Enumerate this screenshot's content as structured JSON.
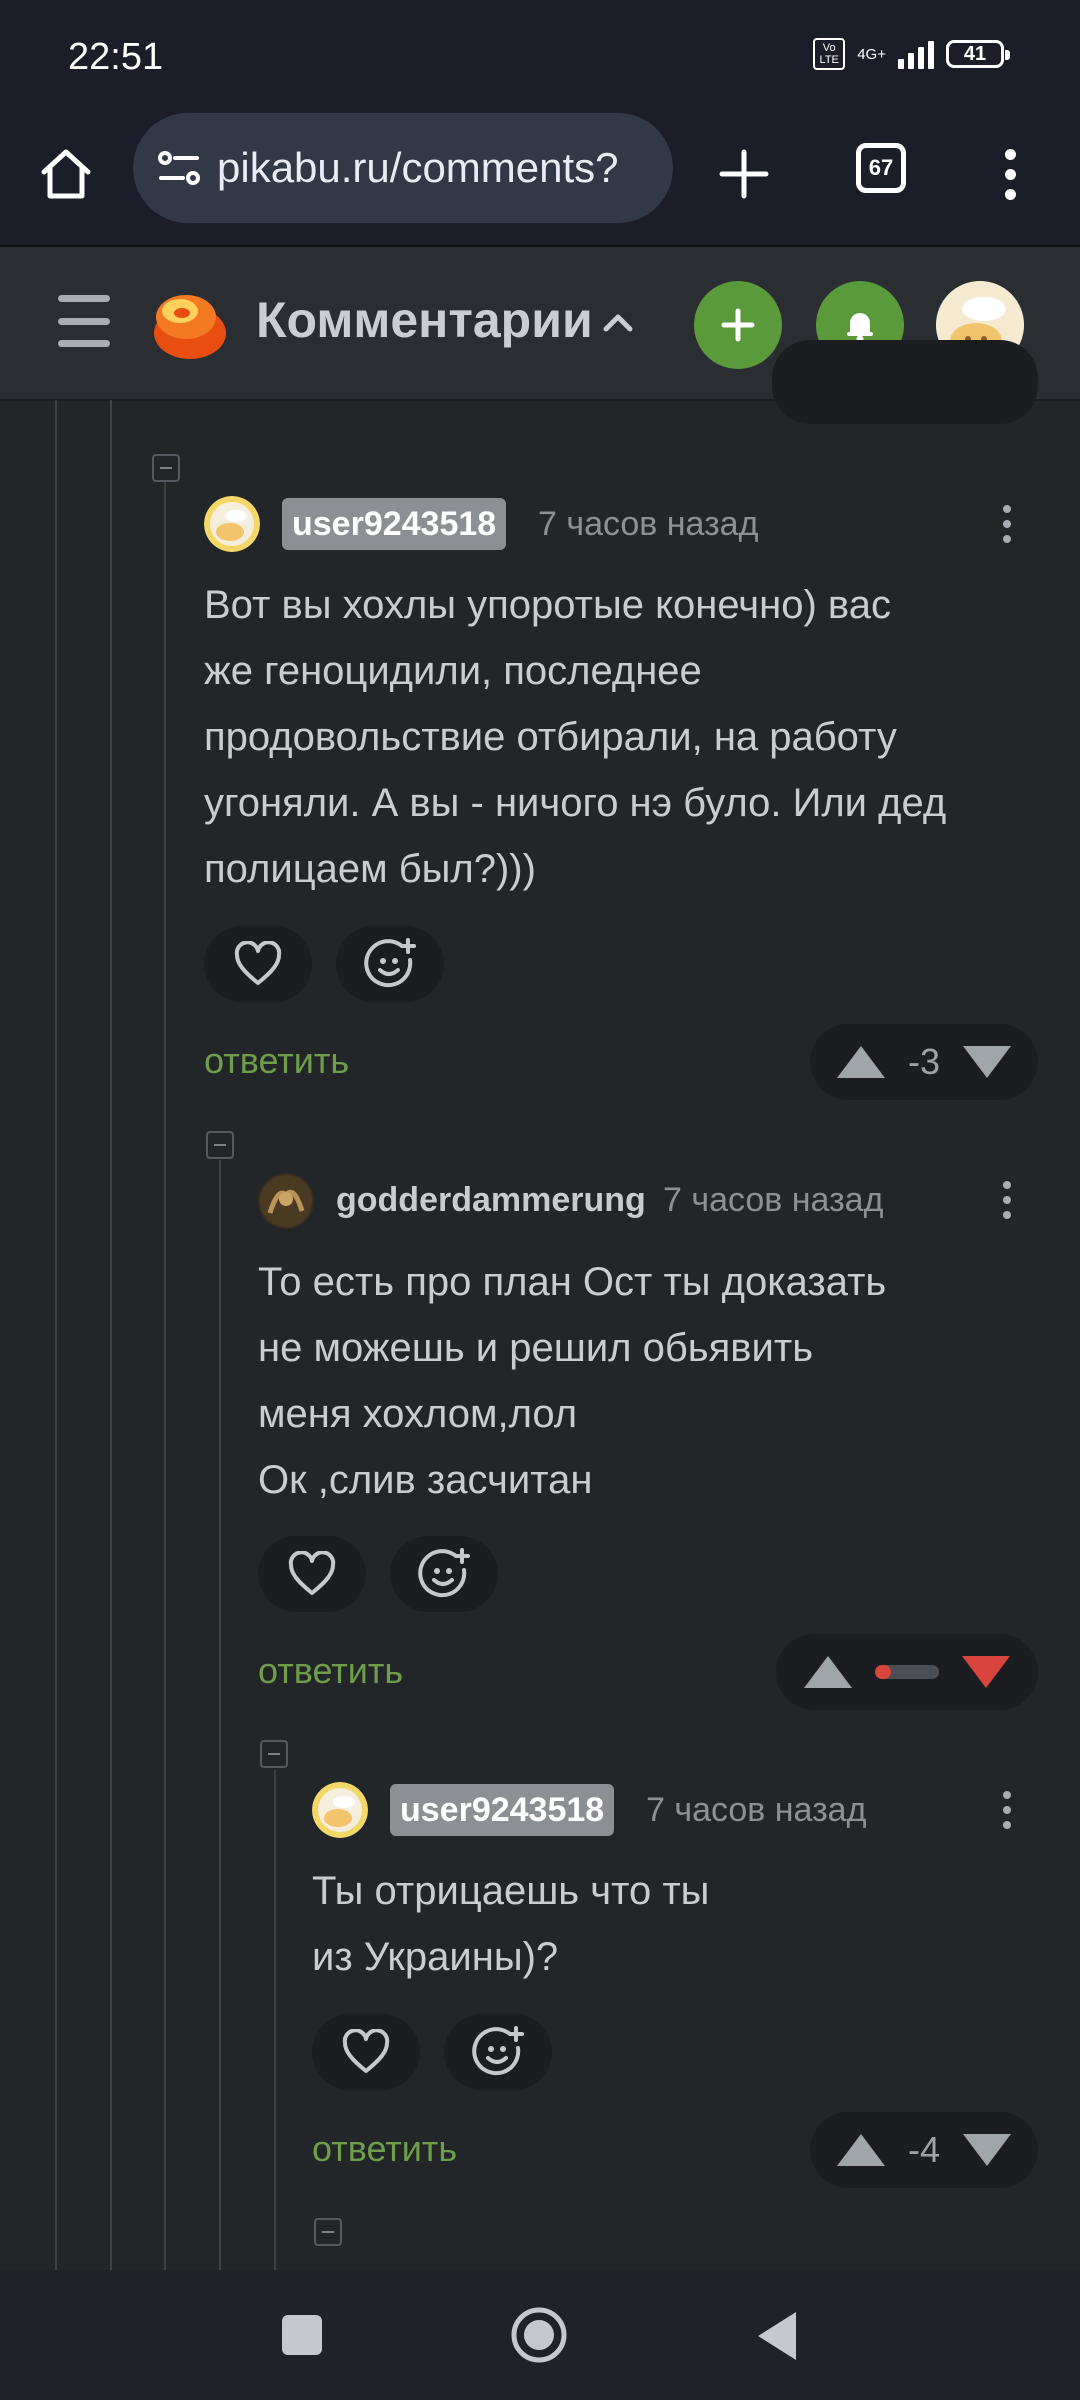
{
  "status_bar": {
    "time": "22:51",
    "volte": "Vo LTE",
    "network": "4G+",
    "battery": "41"
  },
  "browser": {
    "url": "pikabu.ru/comments?",
    "tab_count": "67"
  },
  "header": {
    "title": "Комментарии",
    "accent_color": "#5b9a3b"
  },
  "comments": [
    {
      "username": "user9243518",
      "timestamp": "7 часов назад",
      "text": "Вот вы хохлы упоротые конечно) вас\nже геноцидили, последнее\nпродовольствие отбирали, на работу\nугоняли. А вы - ничого нэ було. Или дед\nполицаем был?)))",
      "reply_label": "ответить",
      "score": "-3"
    },
    {
      "username": "godderdammerung",
      "timestamp": "7 часов назад",
      "text": "То есть про план Ост ты доказать\nне можешь и решил обьявить\nменя хохлом,лол\nОк ,слив засчитан",
      "reply_label": "ответить",
      "downvote_ratio": 0.25
    },
    {
      "username": "user9243518",
      "timestamp": "7 часов назад",
      "text": "Ты отрицаешь что ты\nиз Украины)?",
      "reply_label": "ответить",
      "score": "-4"
    }
  ]
}
